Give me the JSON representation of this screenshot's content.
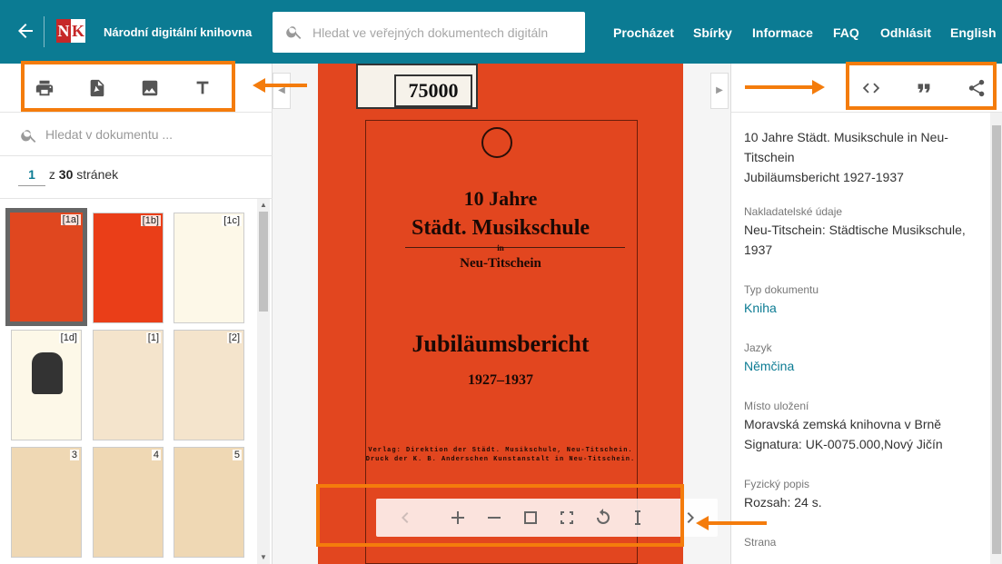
{
  "header": {
    "brand": "Národní digitální knihovna",
    "search_placeholder": "Hledat ve veřejných dokumentech digitáln",
    "nav": [
      "Procházet",
      "Sbírky",
      "Informace",
      "FAQ",
      "Odhlásit",
      "English"
    ]
  },
  "left": {
    "doc_search_placeholder": "Hledat v dokumentu ...",
    "pager": {
      "current": "1",
      "of": "z",
      "total": "30",
      "pages_label": "stránek"
    },
    "thumbs": [
      {
        "label": "[1a]"
      },
      {
        "label": "[1b]"
      },
      {
        "label": "[1c]"
      },
      {
        "label": "[1d]"
      },
      {
        "label": "[1]"
      },
      {
        "label": "[2]"
      },
      {
        "label": "3"
      },
      {
        "label": "4"
      },
      {
        "label": "5"
      }
    ]
  },
  "page": {
    "tag": "75000",
    "line1": "10 Jahre",
    "line2": "Städt. Musikschule",
    "line3": "in",
    "line4": "Neu-Titschein",
    "line5": "Jubiläumsbericht",
    "line6": "1927–1937",
    "pub1": "Verlag: Direktion der Städt. Musikschule, Neu-Titschein.",
    "pub2": "Druck der K. B. Anderschen Kunstanstalt in Neu-Titschein."
  },
  "meta": {
    "title": "10 Jahre Städt. Musikschule in Neu-Titschein",
    "subtitle": "Jubiläumsbericht 1927-1937",
    "publisher_label": "Nakladatelské údaje",
    "publisher": "Neu-Titschein: Städtische Musikschule, 1937",
    "doctype_label": "Typ dokumentu",
    "doctype": "Kniha",
    "language_label": "Jazyk",
    "language": "Němčina",
    "location_label": "Místo uložení",
    "location": "Moravská zemská knihovna v Brně",
    "signature": "Signatura: UK-0075.000,Nový Jičín",
    "physical_label": "Fyzický popis",
    "physical": "Rozsah: 24 s.",
    "page_label": "Strana"
  },
  "colors": {
    "header": "#0b7b93",
    "accent": "#f47c0c",
    "link": "#0b7b93",
    "cover": "#e2461f"
  }
}
